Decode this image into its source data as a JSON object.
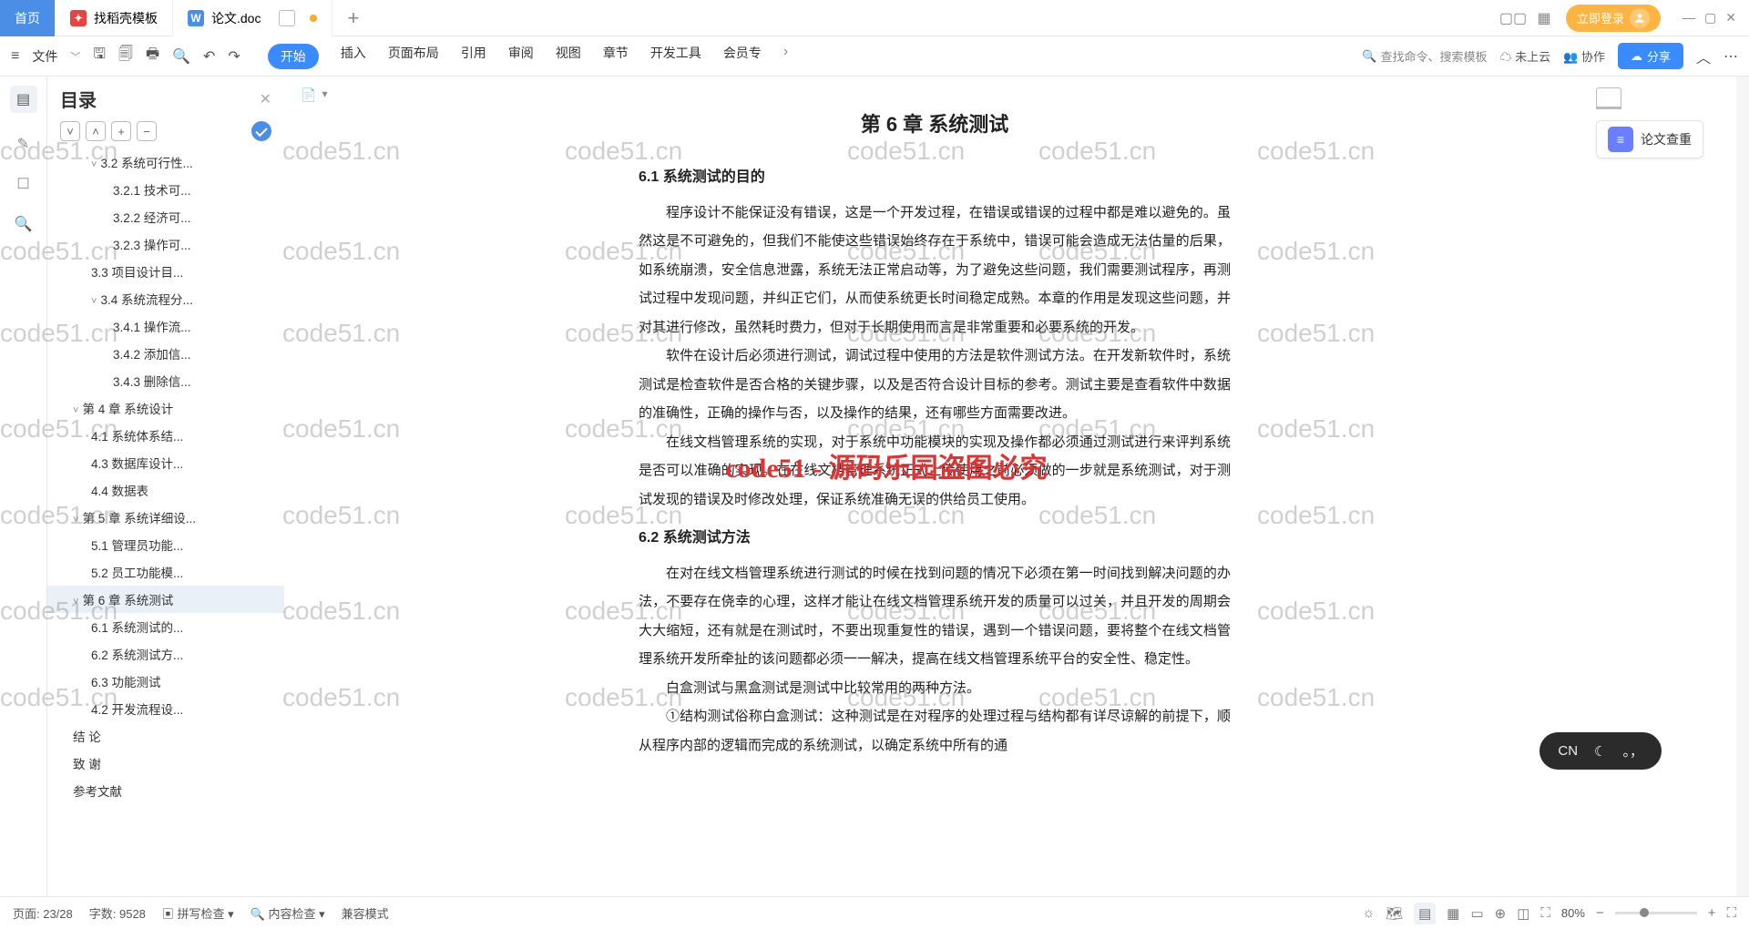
{
  "tabs": {
    "home": "首页",
    "template": "找稻壳模板",
    "doc": "论文.doc"
  },
  "top_right": {
    "login": "立即登录"
  },
  "ribbon": {
    "file_menu": "文件",
    "tabs": [
      "开始",
      "插入",
      "页面布局",
      "引用",
      "审阅",
      "视图",
      "章节",
      "开发工具",
      "会员专"
    ],
    "search_placeholder": "查找命令、搜索模板",
    "cloud": "未上云",
    "coop": "协作",
    "share": "分享"
  },
  "outline": {
    "title": "目录",
    "items": [
      {
        "lv": 2,
        "chev": "˅",
        "text": "3.2 系统可行性..."
      },
      {
        "lv": 3,
        "text": "3.2.1 技术可..."
      },
      {
        "lv": 3,
        "text": "3.2.2 经济可..."
      },
      {
        "lv": 3,
        "text": "3.2.3 操作可..."
      },
      {
        "lv": 2,
        "text": "3.3 项目设计目..."
      },
      {
        "lv": 2,
        "chev": "˅",
        "text": "3.4 系统流程分..."
      },
      {
        "lv": 3,
        "text": "3.4.1 操作流..."
      },
      {
        "lv": 3,
        "text": "3.4.2 添加信..."
      },
      {
        "lv": 3,
        "text": "3.4.3 删除信..."
      },
      {
        "lv": 1,
        "chev": "˅",
        "text": "第 4 章  系统设计"
      },
      {
        "lv": 2,
        "text": "4.1 系统体系结..."
      },
      {
        "lv": 2,
        "text": "4.3 数据库设计..."
      },
      {
        "lv": 2,
        "text": "4.4 数据表"
      },
      {
        "lv": 1,
        "chev": "˅",
        "text": "第 5 章  系统详细设..."
      },
      {
        "lv": 2,
        "text": "5.1 管理员功能..."
      },
      {
        "lv": 2,
        "text": "5.2 员工功能模..."
      },
      {
        "lv": 1,
        "chev": "˅",
        "text": "第 6 章   系统测试",
        "sel": true
      },
      {
        "lv": 2,
        "text": "6.1 系统测试的..."
      },
      {
        "lv": 2,
        "text": "6.2 系统测试方..."
      },
      {
        "lv": 2,
        "text": "6.3 功能测试"
      },
      {
        "lv": 2,
        "text": "4.2 开发流程设..."
      },
      {
        "lv": 1,
        "text": "结    论"
      },
      {
        "lv": 1,
        "text": "致    谢"
      },
      {
        "lv": 1,
        "text": "参考文献"
      }
    ]
  },
  "doc": {
    "h1": "第 6 章    系统测试",
    "h2a": "6.1 系统测试的目的",
    "p1": "程序设计不能保证没有错误，这是一个开发过程，在错误或错误的过程中都是难以避免的。虽然这是不可避免的，但我们不能使这些错误始终存在于系统中，错误可能会造成无法估量的后果，如系统崩溃，安全信息泄露，系统无法正常启动等，为了避免这些问题，我们需要测试程序，再测试过程中发现问题，并纠正它们，从而使系统更长时间稳定成熟。本章的作用是发现这些问题，并对其进行修改，虽然耗时费力，但对于长期使用而言是非常重要和必要系统的开发。",
    "p2": "软件在设计后必须进行测试，调试过程中使用的方法是软件测试方法。在开发新软件时，系统测试是检查软件是否合格的关键步骤，以及是否符合设计目标的参考。测试主要是查看软件中数据的准确性，正确的操作与否，以及操作的结果，还有哪些方面需要改进。",
    "p3": "在线文档管理系统的实现，对于系统中功能模块的实现及操作都必须通过测试进行来评判系统是否可以准确的实现。在在线文档管理系统正式上传使用之前必须做的一步就是系统测试，对于测试发现的错误及时修改处理，保证系统准确无误的供给员工使用。",
    "h2b": "6.2 系统测试方法",
    "p4": "在对在线文档管理系统进行测试的时候在找到问题的情况下必须在第一时间找到解决问题的办法，不要存在侥幸的心理，这样才能让在线文档管理系统开发的质量可以过关，并且开发的周期会大大缩短，还有就是在测试时，不要出现重复性的错误，遇到一个错误问题，要将整个在线文档管理系统开发所牵扯的该问题都必须一一解决，提高在线文档管理系统平台的安全性、稳定性。",
    "p5": "白盒测试与黑盒测试是测试中比较常用的两种方法。",
    "p6": "①结构测试俗称白盒测试：这种测试是在对程序的处理过程与结构都有详尽谅解的前提下，顺从程序内部的逻辑而完成的系统测试，以确定系统中所有的通",
    "overlay": "code51 - 源码乐园盗图必究"
  },
  "right_panel": {
    "button": "论文查重"
  },
  "ime": {
    "lang": "CN",
    "symbol": "。，"
  },
  "status": {
    "page": "页面: 23/28",
    "words": "字数: 9528",
    "spell": "拼写检查",
    "content": "内容检查",
    "compat": "兼容模式",
    "zoom": "80%"
  },
  "watermark": "code51.cn"
}
